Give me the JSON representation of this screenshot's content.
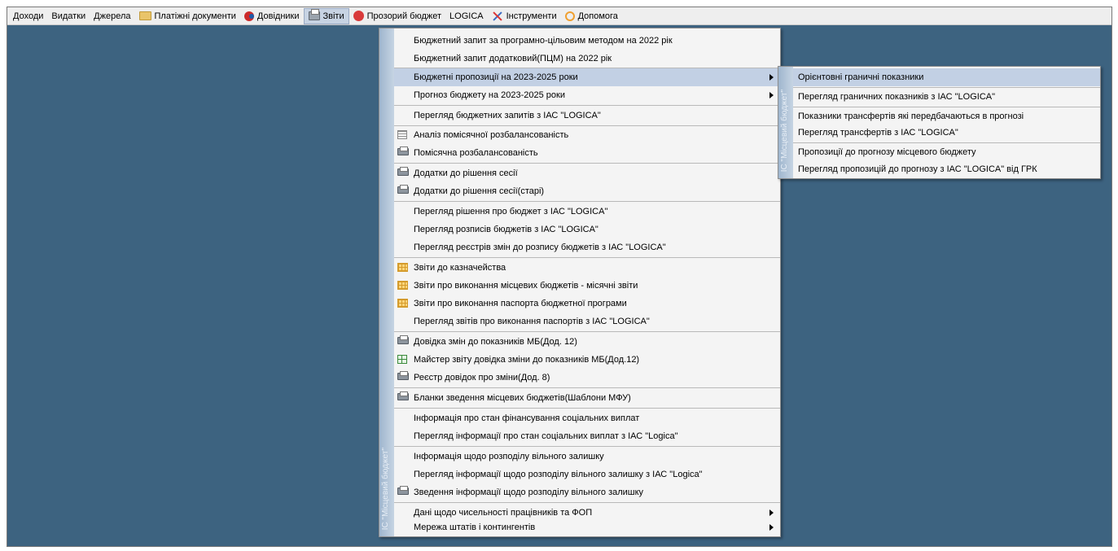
{
  "menubar": {
    "items": [
      {
        "label": "Доходи",
        "icon": ""
      },
      {
        "label": "Видатки",
        "icon": ""
      },
      {
        "label": "Джерела",
        "icon": ""
      },
      {
        "label": "Платіжні документи",
        "icon": "folder-icon"
      },
      {
        "label": "Довідники",
        "icon": "reference-icon"
      },
      {
        "label": "Звіти",
        "icon": "printer-icon",
        "active": true
      },
      {
        "label": "Прозорий бюджет",
        "icon": "circle-icon"
      },
      {
        "label": "LOGICA",
        "icon": ""
      },
      {
        "label": "Інструменти",
        "icon": "tools-icon"
      },
      {
        "label": "Допомога",
        "icon": "help-icon"
      }
    ]
  },
  "reports_menu": {
    "stripe_text": "ІС \"Місцевий бюджет\"",
    "items": [
      {
        "label": "Бюджетний запит за програмно-цільовим методом на 2022 рік"
      },
      {
        "label": "Бюджетний запит додатковий(ПЦМ) на 2022 рік"
      },
      {
        "label": "Бюджетні пропозиції на 2023-2025 роки"
      },
      {
        "label": "Прогноз бюджету на 2023-2025 роки"
      },
      {
        "label": "Перегляд бюджетних запитів  з ІАС \"LOGICA\""
      },
      {
        "label": "Аналіз помісячної розбалансованість"
      },
      {
        "label": "Помісячна розбалансованість"
      },
      {
        "label": "Додатки до рішення сесії"
      },
      {
        "label": "Додатки до рішення сесії(старі)"
      },
      {
        "label": "Перегляд рішення про бюджет  з ІАС \"LOGICA\""
      },
      {
        "label": "Перегляд розписів бюджетів  з ІАС \"LOGICA\""
      },
      {
        "label": "Перегляд реєстрів змін до розпису бюджетів  з ІАС \"LOGICA\""
      },
      {
        "label": "Звіти до казначейства"
      },
      {
        "label": "Звіти про виконання місцевих бюджетів - місячні звіти"
      },
      {
        "label": "Звіти про виконання паспорта бюджетної програми"
      },
      {
        "label": "Перегляд звітів про виконання паспортів  з ІАС \"LOGICA\""
      },
      {
        "label": "Довідка змін до показників МБ(Дод. 12)"
      },
      {
        "label": "Майстер звіту довідка зміни до показників МБ(Дод.12)"
      },
      {
        "label": "Реєстр довідок про зміни(Дод. 8)"
      },
      {
        "label": "Бланки зведення місцевих бюджетів(Шаблони МФУ)"
      },
      {
        "label": "Інформація про стан фінансування соціальних виплат"
      },
      {
        "label": "Перегляд інформації про стан соціальних виплат з ІАС \"Logica\""
      },
      {
        "label": "Інформація щодо розподілу вільного залишку"
      },
      {
        "label": "Перегляд інформації щодо розподілу вільного залишку з ІАС \"Logica\""
      },
      {
        "label": "Зведення інформації щодо розподілу вільного залишку"
      },
      {
        "label": "Дані щодо чисельності працівників та ФОП"
      },
      {
        "label": "Мережа штатів і контингентів"
      }
    ]
  },
  "submenu": {
    "stripe_text": "ІС \"Місцевий бюджет\"",
    "items": [
      {
        "label": "Орієнтовні граничні показники"
      },
      {
        "label": "Перегляд граничних показників  з ІАС \"LOGICA\""
      },
      {
        "label": "Показники  трансфертів які передбачаються в прогнозі"
      },
      {
        "label": "Перегляд трансфертів  з ІАС \"LOGICA\""
      },
      {
        "label": "Пропозиції до прогнозу місцевого бюджету"
      },
      {
        "label": "Перегляд пропозицій до прогнозу з ІАС \"LOGICA\" від ГРК"
      }
    ]
  },
  "colors": {
    "desktop": "#3d6380",
    "menu_bg": "#f4f4f4",
    "highlight": "#c2d0e4"
  }
}
